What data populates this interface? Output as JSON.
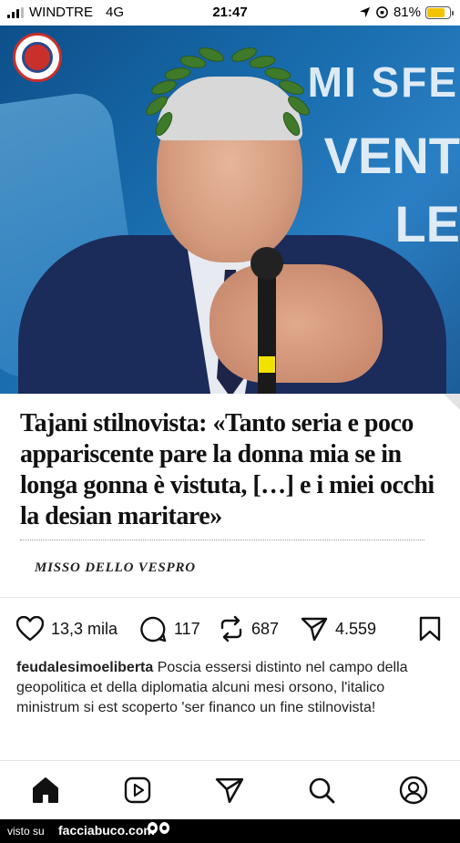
{
  "status_bar": {
    "carrier": "WINDTRE",
    "network": "4G",
    "time": "21:47",
    "battery": "81%",
    "battery_level": 0.81,
    "battery_color": "#f4c300"
  },
  "photo": {
    "background_text": [
      "MI SFE",
      "VENT",
      "LE"
    ],
    "logo_icon": "feudalesimo-logo-icon"
  },
  "article": {
    "headline": "Tajani stilnovista: «Tanto seria e poco appariscente pare la donna mia se in longa gonna è vistuta, […] e i miei occhi la desian maritare»",
    "author": "MISSO DELLO VESPRO"
  },
  "actions": {
    "likes": "13,3 mila",
    "comments": "117",
    "reposts": "687",
    "shares": "4.559"
  },
  "caption": {
    "username": "feudalesimoeliberta",
    "text": " Poscia essersi distinto nel campo della geopolitica et della diplomatia alcuni mesi orsono, l'italico ministrum si est scoperto 'ser financo un fine stilnovista!"
  },
  "nav": {
    "items": [
      "home-icon",
      "reels-icon",
      "send-icon",
      "search-icon",
      "profile-icon"
    ]
  },
  "footer": {
    "prefix": "visto su",
    "site": "facciabuco.com"
  }
}
